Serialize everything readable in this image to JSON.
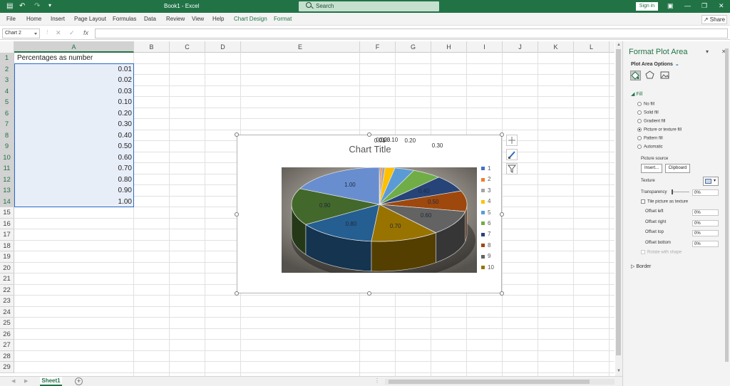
{
  "titlebar": {
    "document": "Book1  -  Excel",
    "search_placeholder": "Search",
    "signin": "Sign in"
  },
  "menu": {
    "tabs": [
      "File",
      "Home",
      "Insert",
      "Page Layout",
      "Formulas",
      "Data",
      "Review",
      "View",
      "Help",
      "Chart Design",
      "Format"
    ],
    "share": "Share"
  },
  "formula_bar": {
    "name_box": "Chart 2",
    "fx": "fx",
    "value": ""
  },
  "grid": {
    "columns": [
      "A",
      "B",
      "C",
      "D",
      "E",
      "F",
      "G",
      "H",
      "I",
      "J",
      "K",
      "L"
    ],
    "rows": [
      "1",
      "2",
      "3",
      "4",
      "5",
      "6",
      "7",
      "8",
      "9",
      "10",
      "11",
      "12",
      "13",
      "14",
      "15",
      "16",
      "17",
      "18",
      "19",
      "20",
      "21",
      "22",
      "23",
      "24",
      "25",
      "26",
      "27",
      "28",
      "29"
    ],
    "col_a": [
      "Percentages as number",
      "0.01",
      "0.02",
      "0.03",
      "0.10",
      "0.20",
      "0.30",
      "0.40",
      "0.50",
      "0.60",
      "0.70",
      "0.80",
      "0.90",
      "1.00"
    ]
  },
  "sheets": {
    "active": "Sheet1"
  },
  "chart": {
    "title": "Chart Title"
  },
  "chart_data": {
    "type": "pie",
    "title": "Chart Title",
    "categories": [
      "1",
      "2",
      "3",
      "4",
      "5",
      "6",
      "7",
      "8",
      "9",
      "10"
    ],
    "values": [
      0.01,
      0.02,
      0.03,
      0.1,
      0.2,
      0.3,
      0.4,
      0.5,
      0.6,
      0.7,
      0.8,
      0.9,
      1.0
    ],
    "data_labels": [
      "0.01",
      "0.02",
      "0.03",
      "0.10",
      "0.20",
      "0.30",
      "0.40",
      "0.50",
      "0.60",
      "0.70",
      "0.80",
      "0.90",
      "1.00"
    ],
    "colors": [
      "#4472c4",
      "#ed7d31",
      "#a5a5a5",
      "#ffc000",
      "#5b9bd5",
      "#70ad47",
      "#264478",
      "#9e480e",
      "#636363",
      "#997300",
      "#255e91",
      "#43682b",
      "#698ed0"
    ],
    "legend": "right",
    "style": "3-D pie"
  },
  "pane": {
    "title": "Format Plot Area",
    "options": "Plot Area Options",
    "fill_section": "Fill",
    "fill_options": [
      "No fill",
      "Solid fill",
      "Gradient fill",
      "Picture or texture fill",
      "Pattern fill",
      "Automatic"
    ],
    "picture_source": "Picture source",
    "insert": "Insert...",
    "clipboard": "Clipboard",
    "texture": "Texture",
    "transparency": "Transparency",
    "transparency_value": "0%",
    "tile": "Tile picture as texture",
    "offsets": [
      "Offset left",
      "Offset right",
      "Offset top",
      "Offset bottom"
    ],
    "offset_values": [
      "0%",
      "0%",
      "0%",
      "0%"
    ],
    "rotate": "Rotate with shape",
    "border_section": "Border"
  }
}
